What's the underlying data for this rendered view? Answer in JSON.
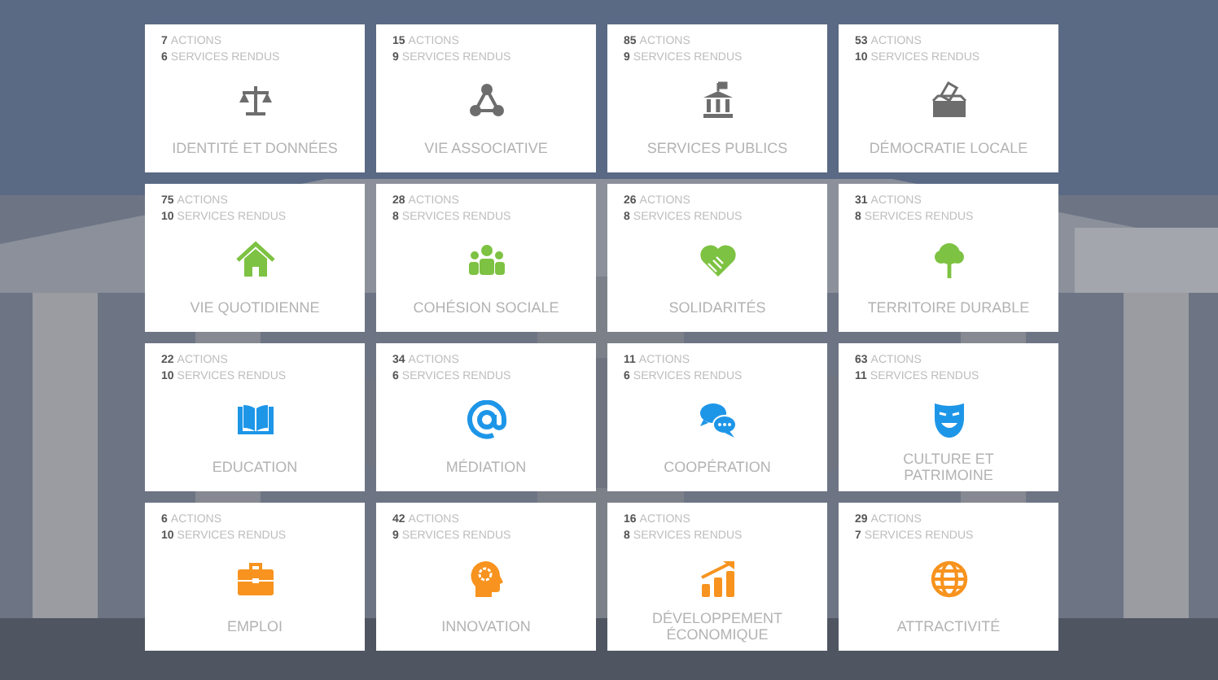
{
  "cards": [
    {
      "actions_count": "7",
      "actions_label": "ACTIONS",
      "services_count": "6",
      "services_label": "SERVICES RENDUS",
      "title": "IDENTITÉ ET DONNÉES",
      "kind": "scales",
      "color": "#6d6d6d"
    },
    {
      "actions_count": "15",
      "actions_label": "ACTIONS",
      "services_count": "9",
      "services_label": "SERVICES RENDUS",
      "title": "VIE ASSOCIATIVE",
      "kind": "network",
      "color": "#6d6d6d"
    },
    {
      "actions_count": "85",
      "actions_label": "ACTIONS",
      "services_count": "9",
      "services_label": "SERVICES RENDUS",
      "title": "SERVICES PUBLICS",
      "kind": "building",
      "color": "#6d6d6d"
    },
    {
      "actions_count": "53",
      "actions_label": "ACTIONS",
      "services_count": "10",
      "services_label": "SERVICES RENDUS",
      "title": "DÉMOCRATIE LOCALE",
      "kind": "ballot",
      "color": "#6d6d6d"
    },
    {
      "actions_count": "75",
      "actions_label": "ACTIONS",
      "services_count": "10",
      "services_label": "SERVICES RENDUS",
      "title": "VIE QUOTIDIENNE",
      "kind": "house",
      "color": "#7dc242"
    },
    {
      "actions_count": "28",
      "actions_label": "ACTIONS",
      "services_count": "8",
      "services_label": "SERVICES RENDUS",
      "title": "COHÉSION SOCIALE",
      "kind": "people",
      "color": "#7dc242"
    },
    {
      "actions_count": "26",
      "actions_label": "ACTIONS",
      "services_count": "8",
      "services_label": "SERVICES RENDUS",
      "title": "SOLIDARITÉS",
      "kind": "heart",
      "color": "#7dc242"
    },
    {
      "actions_count": "31",
      "actions_label": "ACTIONS",
      "services_count": "8",
      "services_label": "SERVICES RENDUS",
      "title": "TERRITOIRE DURABLE",
      "kind": "tree",
      "color": "#7dc242"
    },
    {
      "actions_count": "22",
      "actions_label": "ACTIONS",
      "services_count": "10",
      "services_label": "SERVICES RENDUS",
      "title": "EDUCATION",
      "kind": "book",
      "color": "#1e96e8"
    },
    {
      "actions_count": "34",
      "actions_label": "ACTIONS",
      "services_count": "6",
      "services_label": "SERVICES RENDUS",
      "title": "MÉDIATION",
      "kind": "at",
      "color": "#1e96e8"
    },
    {
      "actions_count": "11",
      "actions_label": "ACTIONS",
      "services_count": "6",
      "services_label": "SERVICES RENDUS",
      "title": "COOPÉRATION",
      "kind": "chat",
      "color": "#1e96e8"
    },
    {
      "actions_count": "63",
      "actions_label": "ACTIONS",
      "services_count": "11",
      "services_label": "SERVICES RENDUS",
      "title": "CULTURE ET PATRIMOINE",
      "kind": "mask",
      "color": "#1e96e8"
    },
    {
      "actions_count": "6",
      "actions_label": "ACTIONS",
      "services_count": "10",
      "services_label": "SERVICES RENDUS",
      "title": "EMPLOI",
      "kind": "briefcase",
      "color": "#f7931e"
    },
    {
      "actions_count": "42",
      "actions_label": "ACTIONS",
      "services_count": "9",
      "services_label": "SERVICES RENDUS",
      "title": "INNOVATION",
      "kind": "head",
      "color": "#f7931e"
    },
    {
      "actions_count": "16",
      "actions_label": "ACTIONS",
      "services_count": "8",
      "services_label": "SERVICES RENDUS",
      "title": "DÉVELOPPEMENT ÉCONOMIQUE",
      "kind": "growth",
      "color": "#f7931e"
    },
    {
      "actions_count": "29",
      "actions_label": "ACTIONS",
      "services_count": "7",
      "services_label": "SERVICES RENDUS",
      "title": "ATTRACTIVITÉ",
      "kind": "globe",
      "color": "#f7931e"
    }
  ]
}
